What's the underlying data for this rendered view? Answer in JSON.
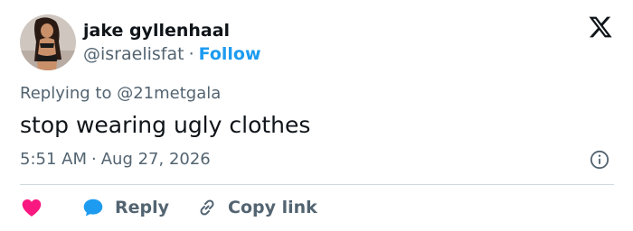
{
  "author": {
    "display_name": "jake gyllenhaal",
    "handle": "@israelisfat",
    "separator": "·",
    "follow_label": "Follow"
  },
  "reply_context": {
    "text": "Replying to @21metgala"
  },
  "tweet": {
    "text": "stop wearing ugly clothes"
  },
  "meta": {
    "time": "5:51 AM",
    "separator": "·",
    "date": "Aug 27, 2026"
  },
  "actions": {
    "reply_label": "Reply",
    "copy_link_label": "Copy link"
  },
  "icons": {
    "brand": "x-logo-icon",
    "info": "info-icon",
    "like": "heart-icon",
    "reply": "speech-bubble-icon",
    "copy": "link-icon"
  },
  "colors": {
    "like": "#f91880",
    "reply_bubble": "#1d9bf0",
    "follow": "#1d9bf0",
    "text_primary": "#0f1419",
    "text_secondary": "#536471",
    "divider": "#cfd9de"
  }
}
